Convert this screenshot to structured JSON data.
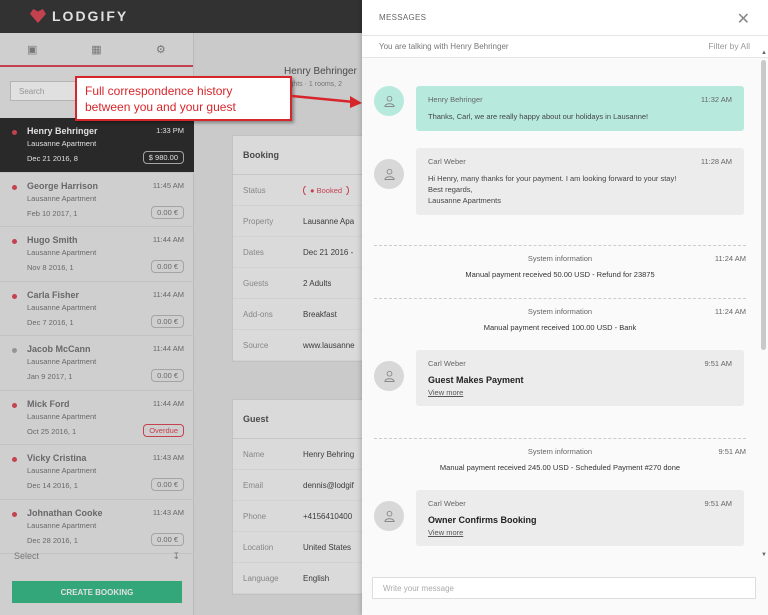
{
  "app": {
    "brand": "LODGIFY",
    "search_placeholder": "Search",
    "select_label": "Select",
    "create_booking": "CREATE BOOKING",
    "header_guest": "Henry Behringer",
    "header_sub": "nights · 1 rooms, 2"
  },
  "bookings": [
    {
      "name": "Henry Behringer",
      "time": "1:33 PM",
      "property": "Lausanne Apartment",
      "dates": "Dec 21 2016, 8",
      "price": "$ 980.00",
      "active": true
    },
    {
      "name": "George Harrison",
      "time": "11:45 AM",
      "property": "Lausanne Apartment",
      "dates": "Feb 10 2017, 1",
      "price": "0.00 €"
    },
    {
      "name": "Hugo Smith",
      "time": "11:44 AM",
      "property": "Lausanne Apartment",
      "dates": "Nov 8 2016, 1",
      "price": "0.00 €"
    },
    {
      "name": "Carla Fisher",
      "time": "11:44 AM",
      "property": "Lausanne Apartment",
      "dates": "Dec 7 2016, 1",
      "price": "0.00 €"
    },
    {
      "name": "Jacob McCann",
      "time": "11:44 AM",
      "property": "Lausanne Apartment",
      "dates": "Jan 9 2017, 1",
      "price": "0.00 €"
    },
    {
      "name": "Mick Ford",
      "time": "11:44 AM",
      "property": "Lausanne Apartment",
      "dates": "Oct 25 2016, 1",
      "price": "Overdue"
    },
    {
      "name": "Vicky Cristina",
      "time": "11:43 AM",
      "property": "Lausanne Apartment",
      "dates": "Dec 14 2016, 1",
      "price": "0.00 €"
    },
    {
      "name": "Johnathan Cooke",
      "time": "11:43 AM",
      "property": "Lausanne Apartment",
      "dates": "Dec 28 2016, 1",
      "price": "0.00 €"
    }
  ],
  "booking_card": {
    "title": "Booking",
    "rows": [
      {
        "k": "Status",
        "v": "Booked"
      },
      {
        "k": "Property",
        "v": "Lausanne Apa"
      },
      {
        "k": "Dates",
        "v": "Dec 21 2016 -"
      },
      {
        "k": "Guests",
        "v": "2 Adults"
      },
      {
        "k": "Add-ons",
        "v": "Breakfast"
      },
      {
        "k": "Source",
        "v": "www.lausanne"
      }
    ]
  },
  "guest_card": {
    "title": "Guest",
    "rows": [
      {
        "k": "Name",
        "v": "Henry Behring"
      },
      {
        "k": "Email",
        "v": "dennis@lodgif"
      },
      {
        "k": "Phone",
        "v": "+4156410400"
      },
      {
        "k": "Location",
        "v": "United States"
      },
      {
        "k": "Language",
        "v": "English"
      }
    ]
  },
  "callout": {
    "line1": "Full correspondence history",
    "line2": "between you and your guest"
  },
  "panel": {
    "title": "MESSAGES",
    "talking_to": "You are talking with Henry Behringer",
    "filter": "Filter by All",
    "compose_placeholder": "Write your message"
  },
  "messages": [
    {
      "type": "msg",
      "sender": "Henry Behringer",
      "time": "11:32 AM",
      "text": "Thanks, Carl, we are really happy about our holidays in Lausanne!",
      "teal": true
    },
    {
      "type": "msg",
      "sender": "Carl Weber",
      "time": "11:28 AM",
      "text_lines": [
        "Hi Henry, many thanks for your payment. I am looking forward to your stay!",
        "Best regards,",
        "Lausanne Apartments"
      ]
    },
    {
      "type": "sys",
      "label": "System information",
      "time": "11:24 AM",
      "text": "Manual payment received 50.00 USD - Refund for 23875"
    },
    {
      "type": "sys",
      "label": "System information",
      "time": "11:24 AM",
      "text": "Manual payment received 100.00 USD - Bank"
    },
    {
      "type": "msg",
      "sender": "Carl Weber",
      "time": "9:51 AM",
      "headline": "Guest Makes Payment",
      "link": "View more"
    },
    {
      "type": "sys",
      "label": "System information",
      "time": "9:51 AM",
      "text": "Manual payment received 245.00 USD - Scheduled Payment #270 done"
    },
    {
      "type": "msg",
      "sender": "Carl Weber",
      "time": "9:51 AM",
      "headline": "Owner Confirms Booking",
      "link": "View more"
    }
  ]
}
